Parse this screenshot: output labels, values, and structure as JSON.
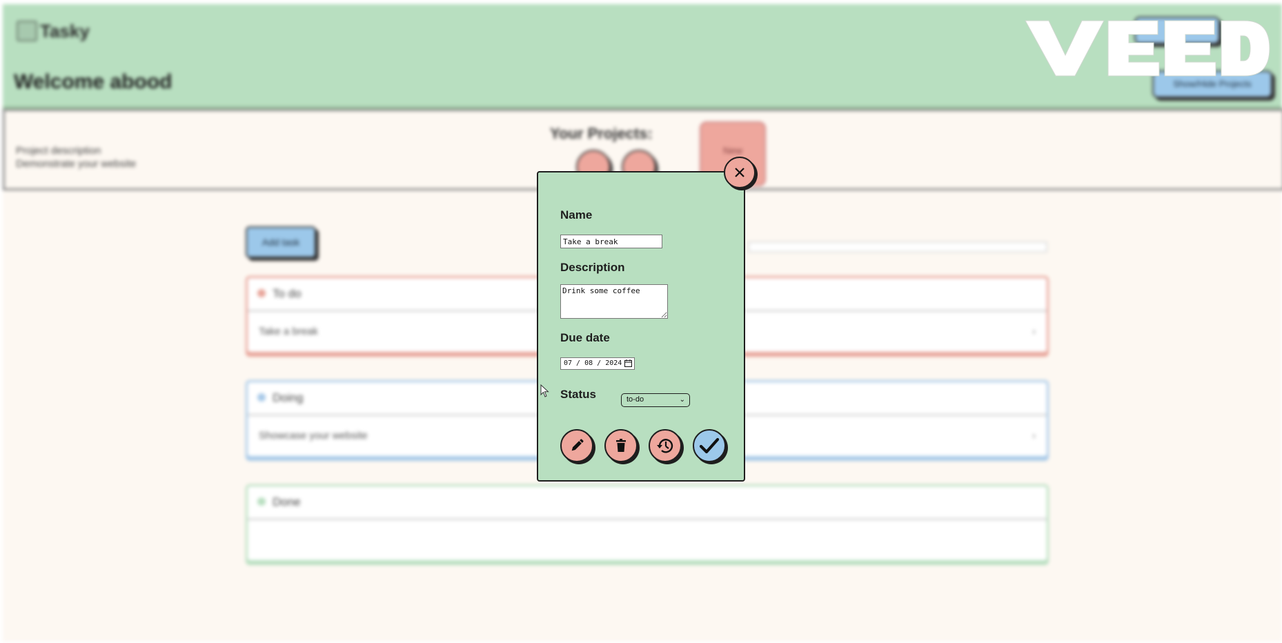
{
  "app": {
    "logo_text": "Tasky",
    "welcome": "Welcome abood",
    "header_button_top_label": "",
    "header_small_text": "",
    "header_button_label": "Show/Hide Projects"
  },
  "project_bar": {
    "description_label": "Project description",
    "description_value": "Demonstrate your website",
    "heading": "Your Projects:",
    "new_card_label": "New"
  },
  "board": {
    "add_task_label": "Add task",
    "groups": [
      {
        "title": "To do",
        "color": "#e8a59a",
        "rows": [
          "Take a break"
        ]
      },
      {
        "title": "Doing",
        "color": "#a7c9e8",
        "rows": [
          "Showcase your website"
        ]
      },
      {
        "title": "Done",
        "color": "#b8dfc0",
        "rows": [
          ""
        ]
      }
    ]
  },
  "watermark": {
    "text": "VEED"
  },
  "modal": {
    "name_label": "Name",
    "name_value": "Take a break",
    "description_label": "Description",
    "description_value": "Drink some coffee",
    "due_date_label": "Due date",
    "due_date_value": "07 / 08 / 2024",
    "status_label": "Status",
    "status_value": "to-do",
    "actions": [
      "edit-icon",
      "trash-icon",
      "history-icon",
      "check-icon"
    ]
  },
  "colors": {
    "header_green": "#b8dfc0",
    "pink": "#eea79d",
    "blue": "#9cc8ea",
    "background": "#fdf8f2"
  }
}
